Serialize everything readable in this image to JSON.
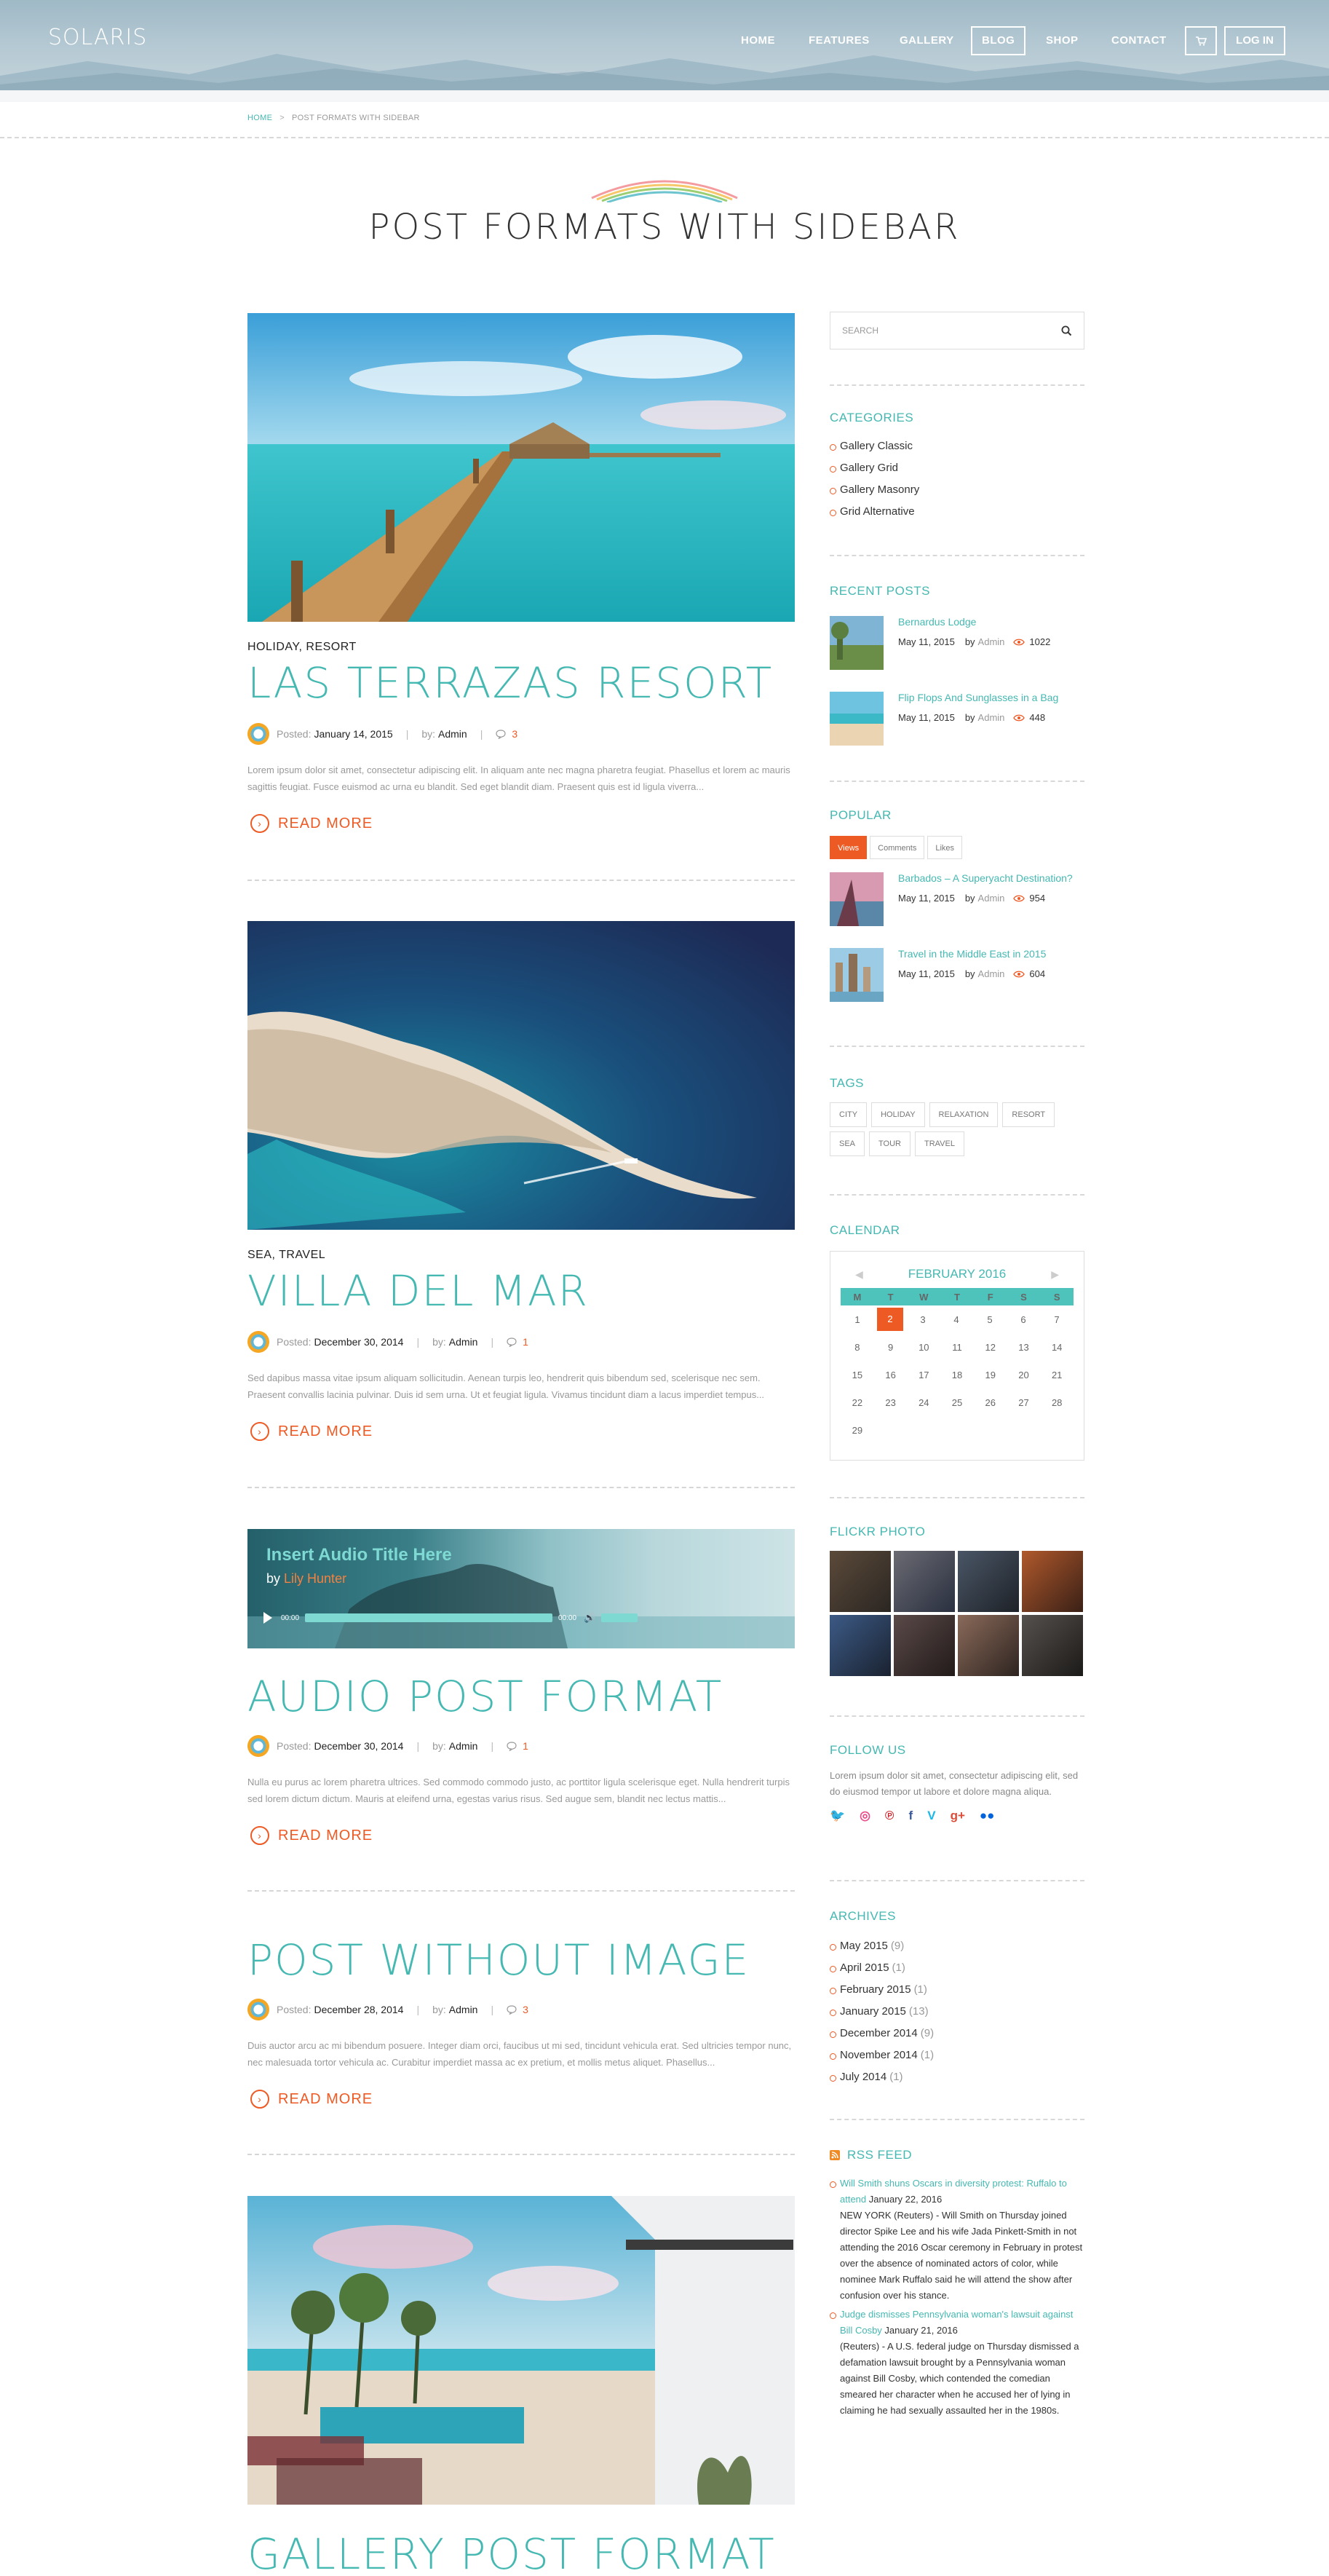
{
  "header": {
    "logo": "SOLARIS",
    "nav": [
      {
        "label": "HOME"
      },
      {
        "label": "FEATURES"
      },
      {
        "label": "GALLERY"
      },
      {
        "label": "BLOG"
      },
      {
        "label": "SHOP"
      },
      {
        "label": "CONTACT"
      }
    ],
    "login_label": "LOG IN"
  },
  "breadcrumb": {
    "home": "HOME",
    "current": "POST FORMATS WITH SIDEBAR"
  },
  "page_title": "POST FORMATS WITH SIDEBAR",
  "posts": [
    {
      "categories": "HOLIDAY, RESORT",
      "title": "LAS TERRAZAS RESORT",
      "posted_label": "Posted:",
      "date": "January 14, 2015",
      "by_label": "by:",
      "author": "Admin",
      "comments": "3",
      "excerpt": "Lorem ipsum dolor sit amet, consectetur adipiscing elit. In aliquam ante nec magna pharetra feugiat. Phasellus et lorem ac mauris sagittis feugiat. Fusce euismod ac urna eu blandit. Sed eget blandit diam. Praesent quis est id ligula viverra...",
      "read_more": "READ MORE"
    },
    {
      "categories": "SEA, TRAVEL",
      "title": "VILLA DEL MAR",
      "posted_label": "Posted:",
      "date": "December 30, 2014",
      "by_label": "by:",
      "author": "Admin",
      "comments": "1",
      "excerpt": "Sed dapibus massa vitae ipsum aliquam sollicitudin. Aenean turpis leo, hendrerit quis bibendum sed, scelerisque nec sem. Praesent convallis lacinia pulvinar. Duis id sem urna. Ut et feugiat ligula. Vivamus tincidunt diam a lacus imperdiet tempus...",
      "read_more": "READ MORE"
    },
    {
      "categories": "",
      "title": "AUDIO POST FORMAT",
      "posted_label": "Posted:",
      "date": "December 30, 2014",
      "by_label": "by:",
      "author": "Admin",
      "comments": "1",
      "excerpt": "Nulla eu purus ac lorem pharetra ultrices. Sed commodo commodo justo, ac porttitor ligula scelerisque eget. Nulla hendrerit turpis sed lorem dictum dictum. Mauris at eleifend urna, egestas varius risus. Sed augue sem, blandit nec lectus mattis...",
      "read_more": "READ MORE"
    },
    {
      "categories": "",
      "title": "POST WITHOUT IMAGE",
      "posted_label": "Posted:",
      "date": "December 28, 2014",
      "by_label": "by:",
      "author": "Admin",
      "comments": "3",
      "excerpt": "Duis auctor arcu ac mi bibendum posuere. Integer diam orci, faucibus ut mi sed, tincidunt vehicula erat. Sed ultricies tempor nunc, nec malesuada tortor vehicula ac. Curabitur imperdiet massa ac ex pretium, et mollis metus aliquet. Phasellus...",
      "read_more": "READ MORE"
    },
    {
      "categories": "",
      "title": "GALLERY POST FORMAT"
    }
  ],
  "audio": {
    "title": "Insert Audio Title Here",
    "by": "by",
    "artist": "Lily Hunter",
    "time_start": "00:00",
    "time_end": "00:00",
    "progress": 0
  },
  "sidebar": {
    "search_placeholder": "SEARCH",
    "categories_title": "CATEGORIES",
    "categories": [
      "Gallery Classic",
      "Gallery Grid",
      "Gallery Masonry",
      "Grid Alternative"
    ],
    "recent_title": "RECENT POSTS",
    "recent": [
      {
        "title": "Bernardus Lodge",
        "date": "May 11, 2015",
        "by": "by",
        "author": "Admin",
        "views": "1022"
      },
      {
        "title": "Flip Flops And Sunglasses in a Bag",
        "date": "May 11, 2015",
        "by": "by",
        "author": "Admin",
        "views": "448"
      }
    ],
    "popular_title": "POPULAR",
    "popular_tabs": [
      "Views",
      "Comments",
      "Likes"
    ],
    "popular": [
      {
        "title": "Barbados – A Superyacht Destination?",
        "date": "May 11, 2015",
        "by": "by",
        "author": "Admin",
        "views": "954"
      },
      {
        "title": "Travel in the Middle East in 2015",
        "date": "May 11, 2015",
        "by": "by",
        "author": "Admin",
        "views": "604"
      }
    ],
    "tags_title": "TAGS",
    "tags": [
      "CITY",
      "HOLIDAY",
      "RELAXATION",
      "RESORT",
      "SEA",
      "TOUR",
      "TRAVEL"
    ],
    "calendar_title": "CALENDAR",
    "calendar": {
      "month": "FEBRUARY 2016",
      "weekdays": [
        "M",
        "T",
        "W",
        "T",
        "F",
        "S",
        "S"
      ],
      "weeks": [
        [
          "1",
          "2",
          "3",
          "4",
          "5",
          "6",
          "7"
        ],
        [
          "8",
          "9",
          "10",
          "11",
          "12",
          "13",
          "14"
        ],
        [
          "15",
          "16",
          "17",
          "18",
          "19",
          "20",
          "21"
        ],
        [
          "22",
          "23",
          "24",
          "25",
          "26",
          "27",
          "28"
        ],
        [
          "29",
          "",
          "",
          "",
          "",
          "",
          ""
        ]
      ],
      "today": "2"
    },
    "flickr_title": "FLICKR PHOTO",
    "follow_title": "FOLLOW US",
    "follow_text": "Lorem ipsum dolor sit amet, consectetur adipiscing elit, sed do eiusmod tempor ut labore et dolore magna aliqua.",
    "social": [
      {
        "name": "twitter-icon",
        "glyph": "🐦",
        "color": "#29a9e1"
      },
      {
        "name": "dribbble-icon",
        "glyph": "◎",
        "color": "#ea4c89"
      },
      {
        "name": "pinterest-icon",
        "glyph": "℗",
        "color": "#cb2027"
      },
      {
        "name": "facebook-icon",
        "glyph": "f",
        "color": "#3b5998"
      },
      {
        "name": "vimeo-icon",
        "glyph": "V",
        "color": "#1ab7ea"
      },
      {
        "name": "google-plus-icon",
        "glyph": "g+",
        "color": "#dd4b39"
      },
      {
        "name": "flickr-icon",
        "glyph": "●●",
        "color": "#0063dc"
      }
    ],
    "archives_title": "ARCHIVES",
    "archives": [
      {
        "label": "May 2015",
        "count": "(9)"
      },
      {
        "label": "April 2015",
        "count": "(1)"
      },
      {
        "label": "February 2015",
        "count": "(1)"
      },
      {
        "label": "January 2015",
        "count": "(13)"
      },
      {
        "label": "December 2014",
        "count": "(9)"
      },
      {
        "label": "November 2014",
        "count": "(1)"
      },
      {
        "label": "July 2014",
        "count": "(1)"
      }
    ],
    "rss_title": "RSS FEED",
    "rss": [
      {
        "link": "Will Smith shuns Oscars in diversity protest: Ruffalo to attend",
        "date": "January 22, 2016",
        "text": "NEW YORK (Reuters) - Will Smith on Thursday joined director Spike Lee and his wife Jada Pinkett-Smith in not attending the 2016 Oscar ceremony in February in protest over the absence of nominated actors of color, while nominee Mark Ruffalo said he will attend the show after confusion over his stance."
      },
      {
        "link": "Judge dismisses Pennsylvania woman's lawsuit against Bill Cosby",
        "date": "January 21, 2016",
        "text": "(Reuters) - A U.S. federal judge on Thursday dismissed a defamation lawsuit brought by a Pennsylvania woman against Bill Cosby, which contended the comedian smeared her character when he accused her of lying in claiming he had sexually assaulted her in the 1980s."
      }
    ]
  }
}
